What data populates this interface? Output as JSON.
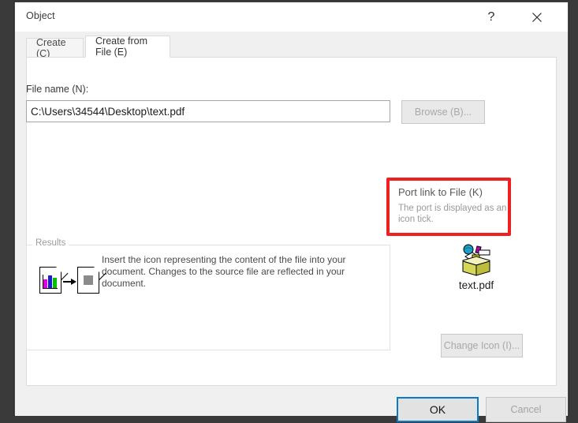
{
  "window": {
    "title": "Object",
    "help_icon": "question-mark-icon",
    "close_icon": "close-icon"
  },
  "tabs": [
    {
      "label": "Create (C)",
      "active": false
    },
    {
      "label": "Create from File (E)",
      "active": true
    }
  ],
  "form": {
    "filename_label": "File name (N):",
    "filename_value": "C:\\Users\\34544\\Desktop\\text.pdf",
    "filename_placeholder": "",
    "browse_label": "Browse (B)...",
    "browse_enabled": false
  },
  "highlight": {
    "title": "Port link to File (K)",
    "description": "The port is displayed as an icon tick.",
    "border_color": "#ee2020"
  },
  "results": {
    "legend": "Results",
    "description": "Insert the icon representing the content of the file into your document. Changes to the source file are reflected in your document.",
    "source_icon": "document-chart-icon",
    "arrow_icon": "arrow-right-icon",
    "target_icon": "document-object-icon"
  },
  "preview": {
    "icon": "package-box-icon",
    "caption": "text.pdf",
    "change_icon_label": "Change Icon (I)...",
    "change_icon_enabled": false
  },
  "footer": {
    "ok_label": "OK",
    "cancel_label": "Cancel",
    "ok_focus_color": "#0a7ac4"
  }
}
